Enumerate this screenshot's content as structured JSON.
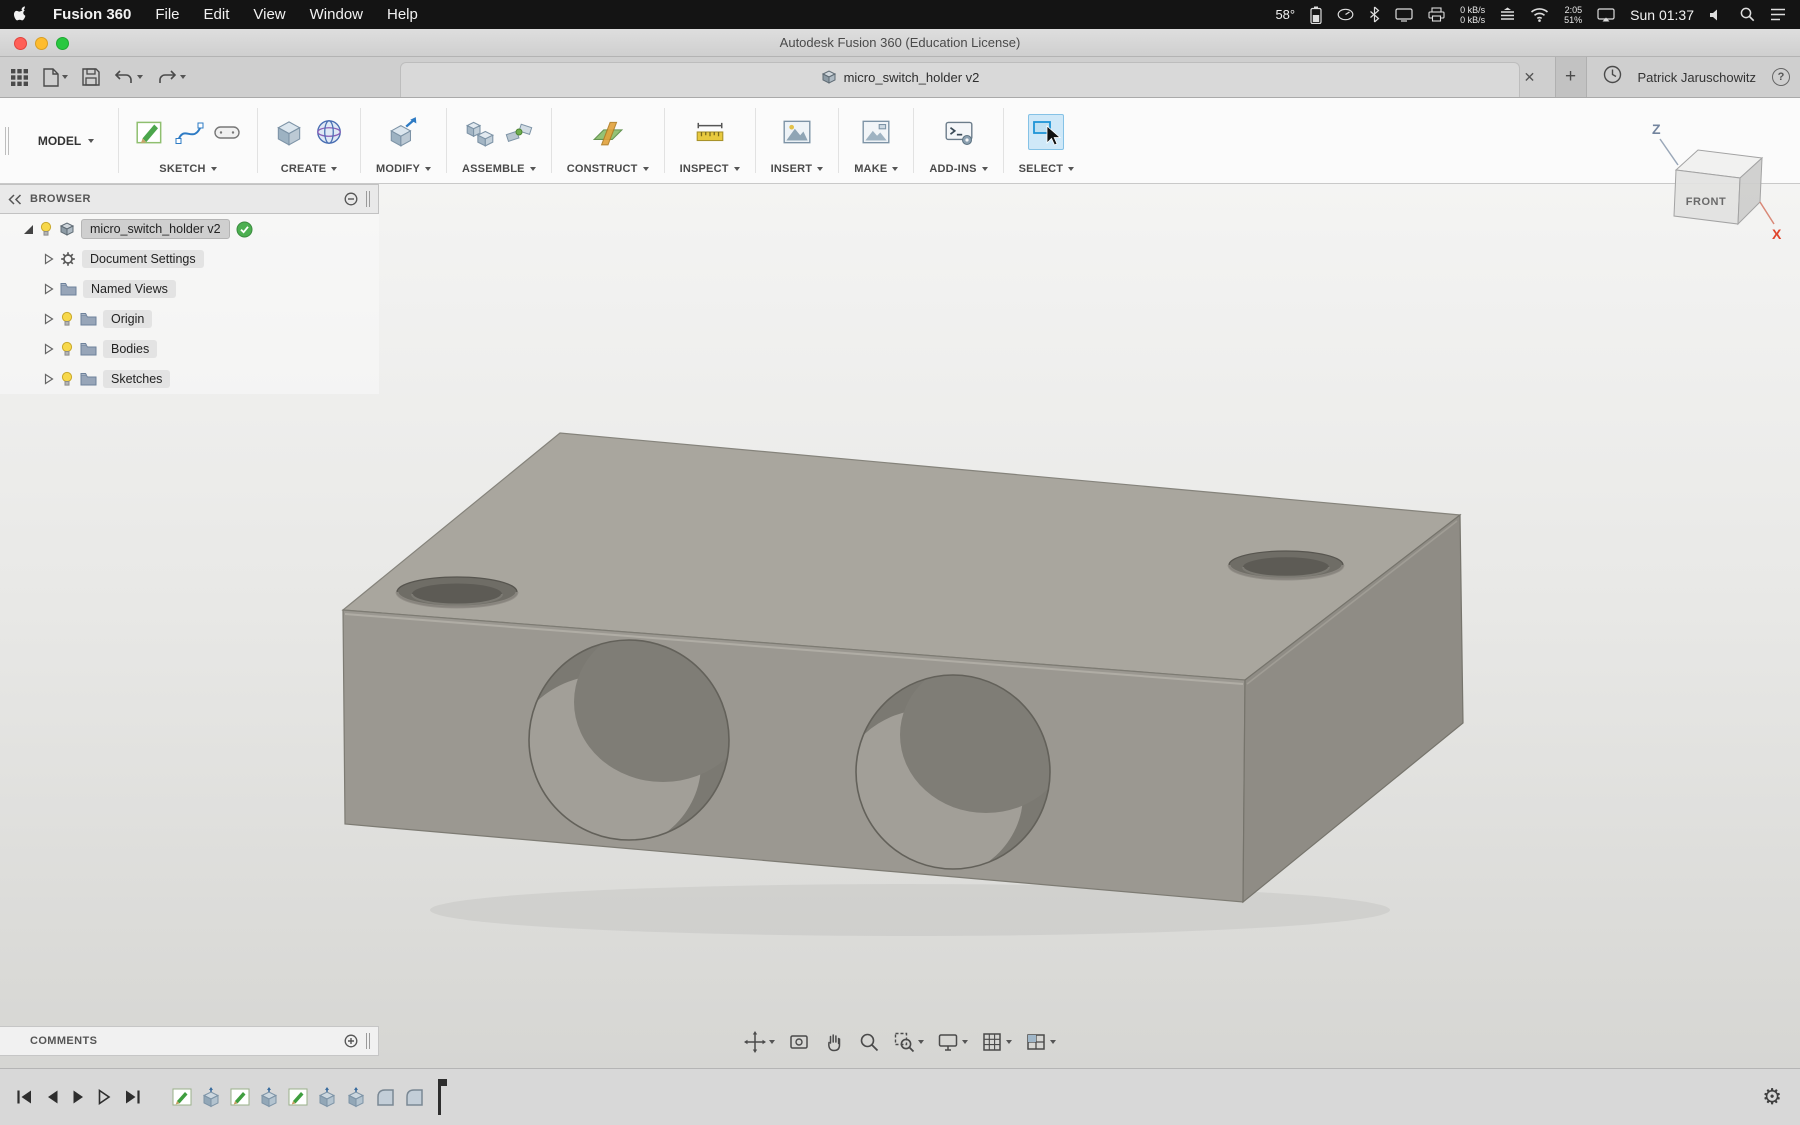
{
  "menubar": {
    "app_name": "Fusion 360",
    "items": [
      "File",
      "Edit",
      "View",
      "Window",
      "Help"
    ],
    "status": {
      "temperature": "58°",
      "net_up": "0 kB/s",
      "net_down": "0 kB/s",
      "clock_small": "2:05",
      "battery_percent": "51%",
      "datetime": "Sun 01:37"
    }
  },
  "window": {
    "title": "Autodesk Fusion 360 (Education License)"
  },
  "tabbar": {
    "document_tab": "micro_switch_holder v2",
    "user_name": "Patrick Jaruschowitz",
    "help": "?",
    "close": "✕",
    "add": "+"
  },
  "ribbon": {
    "workspace": "MODEL",
    "groups": [
      "SKETCH",
      "CREATE",
      "MODIFY",
      "ASSEMBLE",
      "CONSTRUCT",
      "INSPECT",
      "INSERT",
      "MAKE",
      "ADD-INS",
      "SELECT"
    ]
  },
  "browser": {
    "header": "BROWSER",
    "root_item": "micro_switch_holder v2",
    "items": [
      "Document Settings",
      "Named Views",
      "Origin",
      "Bodies",
      "Sketches"
    ]
  },
  "viewcube": {
    "front_label": "FRONT",
    "axis_z": "Z",
    "axis_x": "X"
  },
  "comments": {
    "label": "COMMENTS"
  },
  "icons": {
    "gear": "⚙"
  },
  "colors": {
    "accent_blue": "#1f94d6",
    "select_highlight": "#cfe8f8",
    "sketch_green": "#3f9e3f",
    "axis_x_red": "#e0442c",
    "axis_z_blue": "#73849e",
    "model_top": "#a9a69e",
    "model_front": "#9b9891",
    "model_right": "#8f8c85"
  }
}
